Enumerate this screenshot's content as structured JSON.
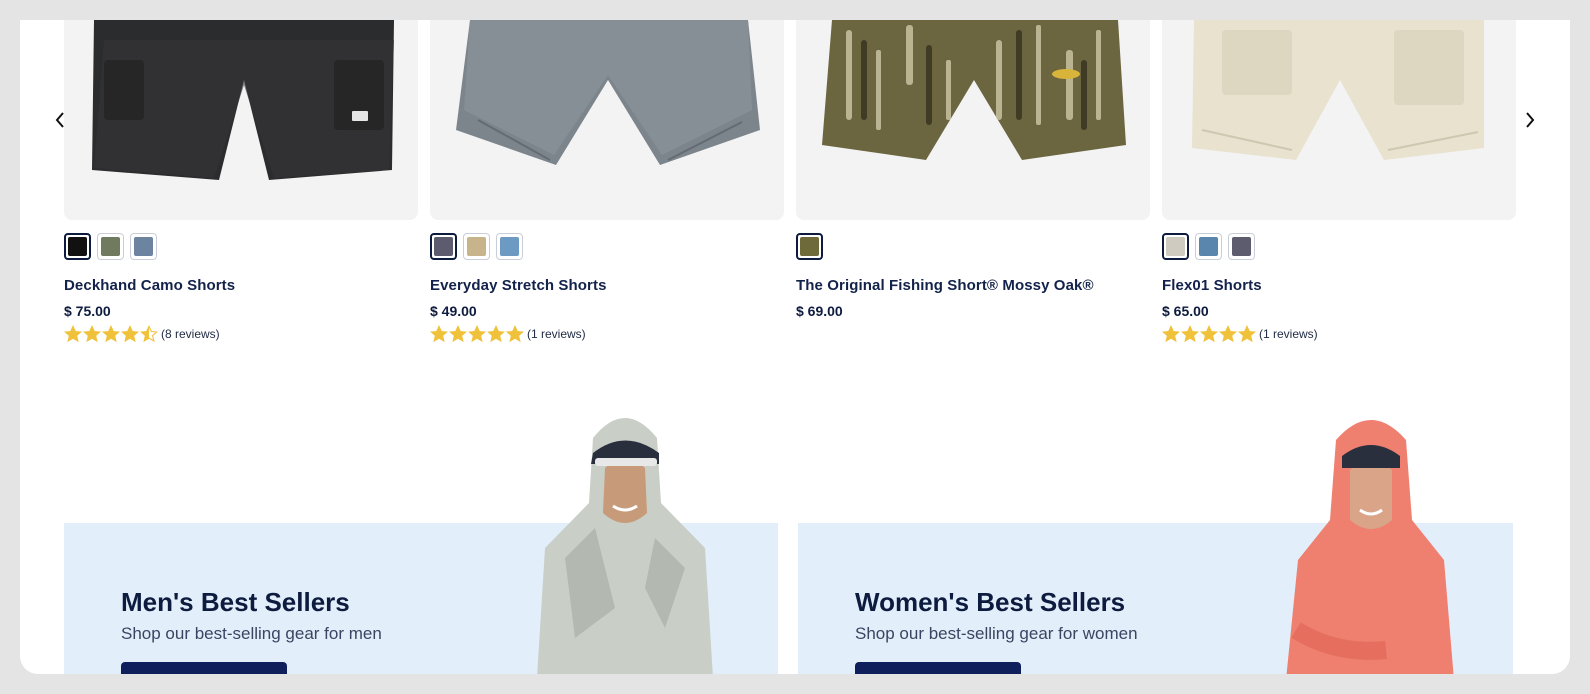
{
  "carousel": {
    "prev_icon": "chevron-left-icon",
    "next_icon": "chevron-right-icon",
    "products": [
      {
        "name": "Deckhand Camo Shorts",
        "price": "$ 75.00",
        "rating": 4.5,
        "reviews": "(8 reviews)",
        "image_color": "#2b2c2e",
        "swatches": [
          "#111111",
          "#6f7a5e",
          "#6c84a0"
        ]
      },
      {
        "name": "Everyday Stretch Shorts",
        "price": "$ 49.00",
        "rating": 5,
        "reviews": "(1 reviews)",
        "image_color": "#7d858c",
        "swatches": [
          "#5c5c6e",
          "#c8b48a",
          "#6c9ac2"
        ]
      },
      {
        "name": "The Original Fishing Short® Mossy Oak®",
        "price": "$ 69.00",
        "rating": null,
        "reviews": "",
        "image_color": "#5e5a3c",
        "swatches": [
          "#6f6a3a"
        ]
      },
      {
        "name": "Flex01 Shorts",
        "price": "$ 65.00",
        "rating": 5,
        "reviews": "(1 reviews)",
        "image_color": "#e8e2cf",
        "swatches": [
          "#cfcbc0",
          "#5a86ad",
          "#5c5c6e"
        ]
      }
    ]
  },
  "colors": {
    "star": "#f0c13a",
    "promo_bg": "#e3eefb",
    "navy": "#0d1b3e"
  },
  "promos": {
    "men": {
      "title": "Men's Best Sellers",
      "subtitle": "Shop our best-selling gear for men",
      "button": ""
    },
    "women": {
      "title": "Women's Best Sellers",
      "subtitle": "Shop our best-selling gear for women",
      "button": ""
    }
  }
}
